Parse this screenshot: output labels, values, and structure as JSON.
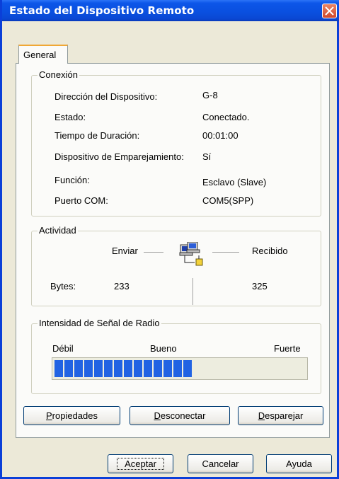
{
  "window": {
    "title": "Estado del Dispositivo Remoto"
  },
  "tabs": [
    {
      "label": "General"
    }
  ],
  "connection": {
    "group_label": "Conexión",
    "rows": [
      {
        "label": "Dirección del Dispositivo:",
        "value": "G-8"
      },
      {
        "label": "Estado:",
        "value": "Conectado."
      },
      {
        "label": "Tiempo de Duración:",
        "value": "00:01:00"
      },
      {
        "label": "Dispositivo de Emparejamiento:",
        "value": "Sí"
      },
      {
        "label": "Función:",
        "value": "Esclavo (Slave)"
      },
      {
        "label": "Puerto COM:",
        "value": "COM5(SPP)"
      }
    ]
  },
  "activity": {
    "group_label": "Actividad",
    "send_label": "Enviar",
    "receive_label": "Recibido",
    "bytes_label": "Bytes:",
    "bytes_sent": "233",
    "bytes_received": "325",
    "icon": "network-computers-icon"
  },
  "signal": {
    "group_label": "Intensidad de Señal de Radio",
    "weak_label": "Débil",
    "good_label": "Bueno",
    "strong_label": "Fuerte",
    "level_fraction": 0.55,
    "bar_color": "#2163e3"
  },
  "panel_buttons": {
    "properties_label": "Propiedades",
    "disconnect_label": "Desconectar",
    "unpair_label": "Desparejar"
  },
  "footer_buttons": {
    "accept_label": "Aceptar",
    "cancel_label": "Cancelar",
    "help_label": "Ayuda"
  }
}
